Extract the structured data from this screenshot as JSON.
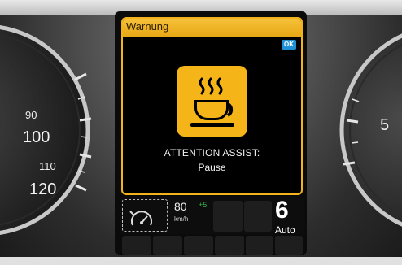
{
  "warning": {
    "header": "Warnung",
    "ok_badge": "OK",
    "icon": "coffee-cup-icon",
    "title": "ATTENTION ASSIST:",
    "value": "Pause"
  },
  "speedometer": {
    "labels": [
      "90",
      "100",
      "110",
      "120"
    ]
  },
  "tachometer": {
    "label": "5"
  },
  "status_bar": {
    "limit_icon": "speed-limiter-icon",
    "limit_value": "80",
    "limit_plus": "+5",
    "limit_unit": "km/h",
    "gear": "6",
    "gear_mode": "Auto"
  },
  "colors": {
    "warning_yellow": "#f5b519",
    "ok_blue": "#1f8fd8",
    "tolerance_green": "#3cb44a"
  }
}
